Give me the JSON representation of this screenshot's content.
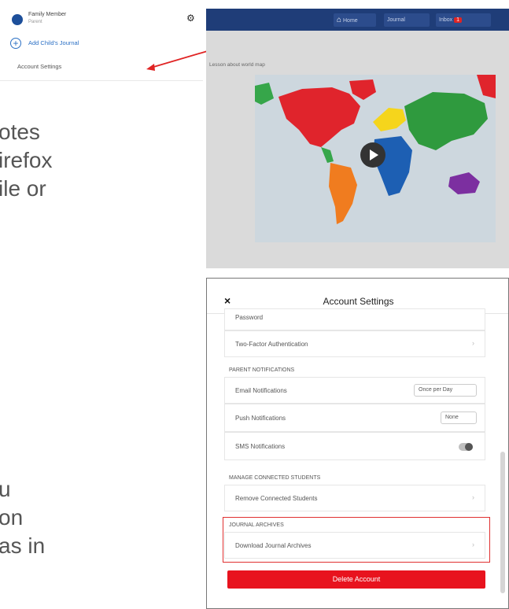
{
  "menu": {
    "user_name": "Family Member",
    "user_role": "Parent",
    "add_child_label": "Add Child's Journal",
    "account_settings_label": "Account Settings"
  },
  "slide_text": {
    "lines_top": [
      "otes",
      "irefox",
      "ile or"
    ],
    "lines_bottom": [
      "u",
      "on",
      "as in"
    ]
  },
  "screenshot_app": {
    "nav": [
      "Home",
      "Journal",
      "Inbox"
    ],
    "inbox_badge": "1",
    "caption": "Lesson about world map",
    "accent": "#1f3d78"
  },
  "settings_modal": {
    "title": "Account Settings",
    "close_label": "×",
    "top_row_cut": "Password",
    "two_factor": "Two-Factor Authentication",
    "parent_notifications_header": "PARENT NOTIFICATIONS",
    "email_notifications": "Email Notifications",
    "email_value": "Once per Day",
    "push_notifications": "Push Notifications",
    "push_value": "None",
    "sms_notifications": "SMS Notifications",
    "manage_header": "MANAGE CONNECTED STUDENTS",
    "remove_students": "Remove Connected Students",
    "journal_archives_header": "JOURNAL ARCHIVES",
    "download_archive": "Download Journal Archives",
    "delete_account": "Delete Account",
    "delete_color": "#e8131e",
    "highlight_color": "#e03030"
  },
  "icons": {
    "gear": "⚙",
    "plus": "+",
    "chevron": "›",
    "home": "⌂"
  }
}
